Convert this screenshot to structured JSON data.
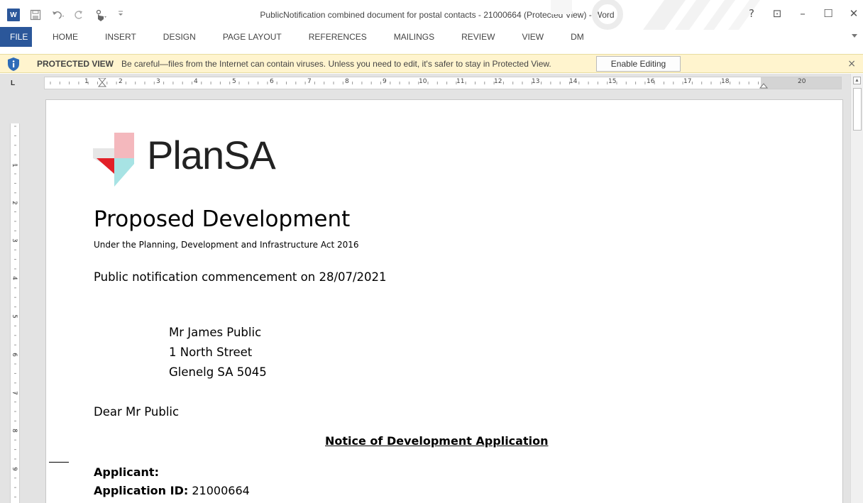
{
  "window": {
    "title": "PublicNotification combined document for postal contacts - 21000664 (Protected View) - Word",
    "app_icon": "W",
    "controls": {
      "help": "?",
      "ribbon_display": "⊡",
      "minimize": "–",
      "maximize": "☐",
      "close": "✕"
    }
  },
  "qat": {
    "save_icon": "save-icon",
    "undo_icon": "undo-icon",
    "redo_icon": "redo-icon",
    "touch_icon": "touch-mode-icon",
    "customize_icon": "customize-icon"
  },
  "ribbon": {
    "tabs": [
      "FILE",
      "HOME",
      "INSERT",
      "DESIGN",
      "PAGE LAYOUT",
      "REFERENCES",
      "MAILINGS",
      "REVIEW",
      "VIEW",
      "DM"
    ],
    "file_color": "#2b579a"
  },
  "protected_view": {
    "title": "PROTECTED VIEW",
    "message": "Be careful—files from the Internet can contain viruses. Unless you need to edit, it's safer to stay in Protected View.",
    "enable_button": "Enable Editing",
    "close": "×",
    "bar_color": "#fff4ce"
  },
  "ruler": {
    "tab_stop": "L",
    "h_numbers": [
      "1",
      "2",
      "3",
      "4",
      "5",
      "6",
      "7",
      "8",
      "9",
      "10",
      "11",
      "12",
      "13",
      "14",
      "15",
      "16",
      "17",
      "18",
      "20"
    ],
    "v_numbers": [
      "1",
      "2",
      "3",
      "4",
      "5",
      "6",
      "7",
      "8",
      "9"
    ]
  },
  "document": {
    "logo_text": "PlanSA",
    "heading": "Proposed Development",
    "subheading": "Under the Planning, Development and Infrastructure Act 2016",
    "notification": "Public notification commencement on 28/07/2021",
    "address": [
      "Mr James Public",
      "1 North Street",
      "Glenelg SA 5045"
    ],
    "salutation": "Dear Mr Public",
    "notice_title": "Notice of Development Application",
    "applicant_label": "Applicant:",
    "application_id_label": "Application ID:",
    "application_id_value": "21000664"
  }
}
